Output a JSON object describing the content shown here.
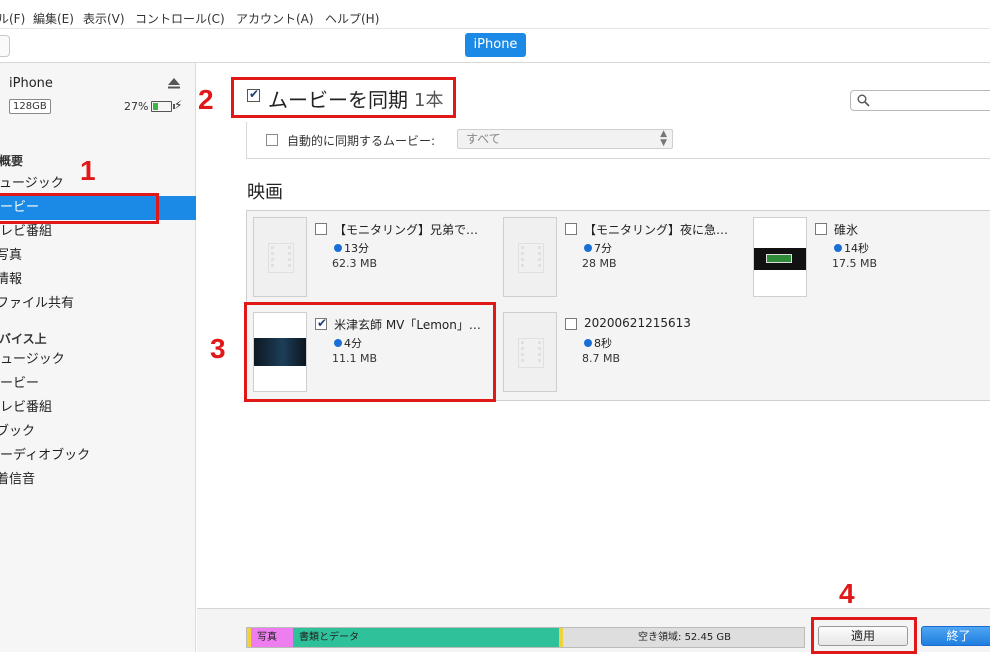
{
  "menu": [
    "ル(F)",
    "編集(E)",
    "表示(V)",
    "コントロール(C)",
    "アカウント(A)",
    "ヘルプ(H)"
  ],
  "toolbar": {
    "device_tab": "iPhone"
  },
  "device": {
    "name": "iPhone",
    "capacity": "128GB",
    "battery": "27%",
    "battery_level": 0.27
  },
  "sidebar": {
    "settings_items": [
      "概要",
      "ュージック",
      "ービー",
      "レビ番組",
      "写真",
      "情報",
      "ファイル共有"
    ],
    "selected_index": 2,
    "on_device_header": "バイス上",
    "on_device_items": [
      "ュージック",
      "ービー",
      "レビ番組",
      "ブック",
      "ーディオブック",
      "着信音"
    ]
  },
  "sync": {
    "label": "ムービーを同期",
    "count": "1本",
    "checked": true
  },
  "auto_sync": {
    "label": "自動的に同期するムービー:",
    "selected": "すべて",
    "checked": false
  },
  "section_title": "映画",
  "movies": [
    {
      "title": "【モニタリング】兄弟で…",
      "duration": "13分",
      "size": "62.3 MB",
      "checked": false,
      "thumb": "blank"
    },
    {
      "title": "【モニタリング】夜に急…",
      "duration": "7分",
      "size": "28 MB",
      "checked": false,
      "thumb": "blank"
    },
    {
      "title": "碓氷",
      "duration": "14秒",
      "size": "17.5 MB",
      "checked": false,
      "thumb": "video-green"
    },
    {
      "title": "米津玄師  MV「Lemon」…",
      "duration": "4分",
      "size": "11.1 MB",
      "checked": true,
      "thumb": "video-dark"
    },
    {
      "title": "20200621215613",
      "duration": "8秒",
      "size": "8.7 MB",
      "checked": false,
      "thumb": "blank"
    }
  ],
  "storage": {
    "segments": [
      {
        "label": "写真",
        "color": "#ee7ef0"
      },
      {
        "label": "書類とデータ",
        "color": "#2fc29a"
      },
      {
        "label": "空き領域: 52.45 GB",
        "color": "#dedede"
      }
    ]
  },
  "buttons": {
    "apply": "適用",
    "done": "終了"
  },
  "annotations": [
    "1",
    "2",
    "3",
    "4"
  ],
  "colors": {
    "accent": "#1a8ae6",
    "annotation": "#e01818"
  }
}
